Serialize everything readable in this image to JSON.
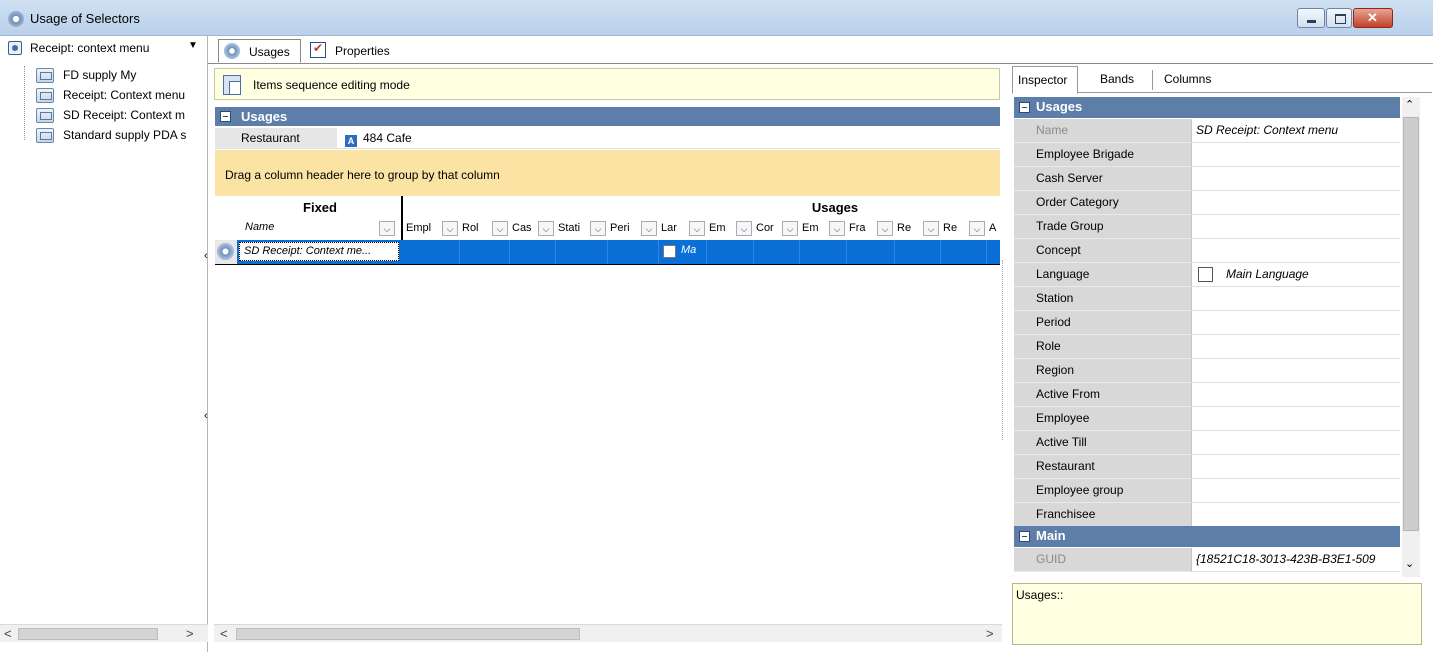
{
  "window": {
    "title": "Usage of Selectors"
  },
  "left_pane": {
    "context_combo": "Receipt: context menu",
    "tree_items": [
      "FD supply My",
      "Receipt: Context menu",
      "SD Receipt: Context m",
      "Standard supply PDA s"
    ]
  },
  "tabs": [
    "Usages",
    "Properties"
  ],
  "center": {
    "mode_label": "Items sequence editing mode",
    "section_title": "Usages",
    "restaurant_label": "Restaurant",
    "restaurant_value": "484 Cafe",
    "restaurant_icon_letter": "A",
    "group_hint": "Drag a column header here to group by that column",
    "bands": {
      "fixed": "Fixed",
      "usages": "Usages"
    },
    "name_column": "Name",
    "columns": [
      "Empl",
      "Rol",
      "Cas",
      "Stati",
      "Peri",
      "Lar",
      "Em",
      "Cor",
      "Em",
      "Fra",
      "Re",
      "Re",
      "A"
    ],
    "row": {
      "name": "SD Receipt: Context me...",
      "language_value": "Ma"
    }
  },
  "inspector": {
    "tabs": [
      "Inspector",
      "Bands",
      "Columns"
    ],
    "categories": {
      "usages": "Usages",
      "main": "Main"
    },
    "properties": [
      {
        "name": "Name",
        "value": "SD Receipt: Context menu",
        "dim": true
      },
      {
        "name": "Employee Brigade",
        "value": ""
      },
      {
        "name": "Cash Server",
        "value": ""
      },
      {
        "name": "Order Category",
        "value": ""
      },
      {
        "name": "Trade Group",
        "value": ""
      },
      {
        "name": "Concept",
        "value": ""
      },
      {
        "name": "Language",
        "value": "Main Language",
        "checkbox": true
      },
      {
        "name": "Station",
        "value": ""
      },
      {
        "name": "Period",
        "value": ""
      },
      {
        "name": "Role",
        "value": ""
      },
      {
        "name": "Region",
        "value": ""
      },
      {
        "name": "Active From",
        "value": ""
      },
      {
        "name": "Employee",
        "value": ""
      },
      {
        "name": "Active Till",
        "value": ""
      },
      {
        "name": "Restaurant",
        "value": ""
      },
      {
        "name": "Employee group",
        "value": ""
      },
      {
        "name": "Franchisee",
        "value": ""
      }
    ],
    "main_properties": [
      {
        "name": "GUID",
        "value": "{18521C18-3013-423B-B3E1-509",
        "dim": true
      }
    ],
    "description": "Usages::"
  },
  "colors": {
    "category_header": "#5d7ea9",
    "selected_row": "#0b6fd8",
    "group_bar": "#fbe3a4",
    "info_bar": "#ffffe1"
  }
}
